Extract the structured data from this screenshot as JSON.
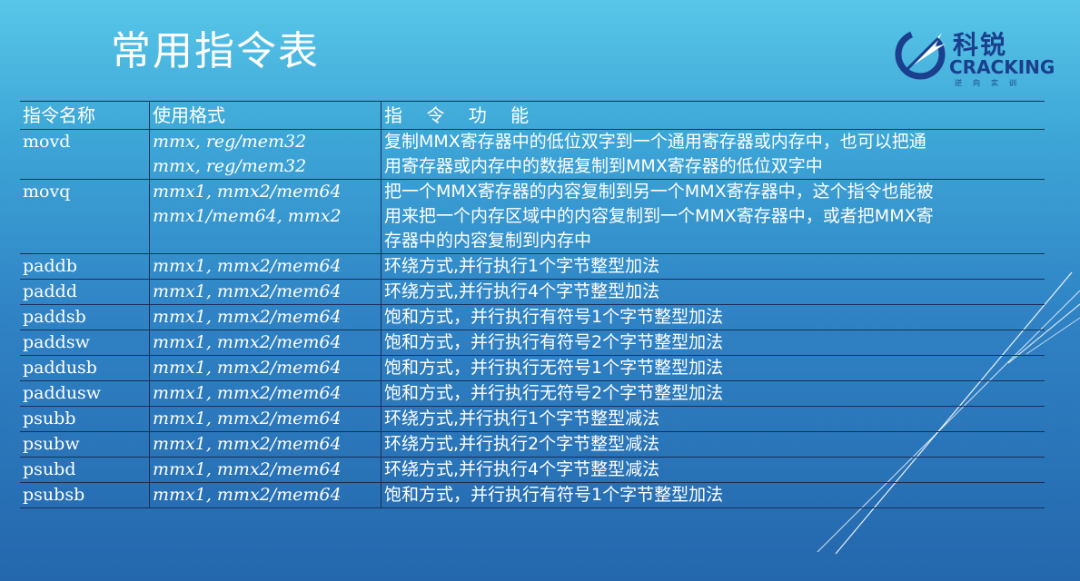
{
  "slide": {
    "title": "常用指令表"
  },
  "logo": {
    "name_cn": "科锐",
    "name_en": "CRACKING",
    "tagline": "逆向实训",
    "color": "#1a3f8c"
  },
  "table": {
    "headers": [
      "指令名称",
      "使用格式",
      "指 令 功 能"
    ],
    "rows": [
      {
        "name": "movd",
        "format": [
          "mmx, reg/mem32",
          "mmx, reg/mem32"
        ],
        "func": [
          "复制MMX寄存器中的低位双字到一个通用寄存器或内存中，也可以把通",
          "用寄存器或内存中的数据复制到MMX寄存器的低位双字中"
        ]
      },
      {
        "name": "movq",
        "format": [
          "mmx1, mmx2/mem64",
          "mmx1/mem64, mmx2"
        ],
        "func": [
          "把一个MMX寄存器的内容复制到另一个MMX寄存器中，这个指令也能被",
          "用来把一个内存区域中的内容复制到一个MMX寄存器中，或者把MMX寄",
          "存器中的内容复制到内存中"
        ]
      },
      {
        "name": "paddb",
        "format": [
          "mmx1, mmx2/mem64"
        ],
        "func": [
          "环绕方式,并行执行1个字节整型加法"
        ]
      },
      {
        "name": "paddd",
        "format": [
          "mmx1, mmx2/mem64"
        ],
        "func": [
          "环绕方式,并行执行4个字节整型加法"
        ]
      },
      {
        "name": "paddsb",
        "format": [
          "mmx1, mmx2/mem64"
        ],
        "func": [
          "饱和方式，并行执行有符号1个字节整型加法"
        ]
      },
      {
        "name": "paddsw",
        "format": [
          "mmx1, mmx2/mem64"
        ],
        "func": [
          "饱和方式，并行执行有符号2个字节整型加法"
        ]
      },
      {
        "name": "paddusb",
        "format": [
          "mmx1, mmx2/mem64"
        ],
        "func": [
          "饱和方式，并行执行无符号1个字节整型加法"
        ]
      },
      {
        "name": "paddusw",
        "format": [
          "mmx1, mmx2/mem64"
        ],
        "func": [
          "饱和方式，并行执行无符号2个字节整型加法"
        ]
      },
      {
        "name": "psubb",
        "format": [
          "mmx1, mmx2/mem64"
        ],
        "func": [
          "环绕方式,并行执行1个字节整型减法"
        ]
      },
      {
        "name": "psubw",
        "format": [
          "mmx1, mmx2/mem64"
        ],
        "func": [
          "环绕方式,并行执行2个字节整型减法"
        ]
      },
      {
        "name": "psubd",
        "format": [
          "mmx1, mmx2/mem64"
        ],
        "func": [
          "环绕方式,并行执行4个字节整型减法"
        ]
      },
      {
        "name": "psubsb",
        "format": [
          "mmx1, mmx2/mem64"
        ],
        "func": [
          "饱和方式，并行执行有符号1个字节整型加法"
        ]
      }
    ]
  }
}
